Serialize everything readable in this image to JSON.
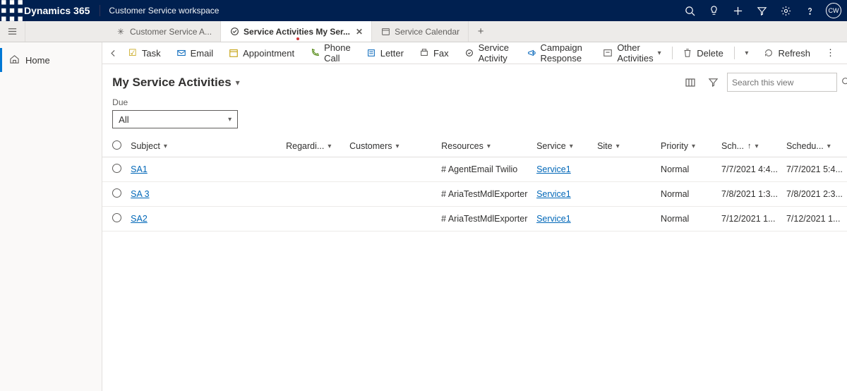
{
  "header": {
    "brand": "Dynamics 365",
    "app_name": "Customer Service workspace",
    "avatar_initials": "CW"
  },
  "tabs": {
    "items": [
      {
        "label": "Customer Service A...",
        "active": false,
        "closable": false
      },
      {
        "label": "Service Activities My Ser...",
        "active": true,
        "closable": true
      },
      {
        "label": "Service Calendar",
        "active": false,
        "closable": false
      }
    ]
  },
  "sidebar": {
    "home_label": "Home"
  },
  "command_bar": {
    "task": "Task",
    "email": "Email",
    "appointment": "Appointment",
    "phone_call": "Phone Call",
    "letter": "Letter",
    "fax": "Fax",
    "service_activity": "Service Activity",
    "campaign_response": "Campaign Response",
    "other_activities": "Other Activities",
    "delete": "Delete",
    "refresh": "Refresh"
  },
  "view": {
    "title": "My Service Activities",
    "search_placeholder": "Search this view",
    "filter": {
      "label": "Due",
      "value": "All"
    }
  },
  "columns": {
    "subject": "Subject",
    "regarding": "Regardi...",
    "customers": "Customers",
    "resources": "Resources",
    "service": "Service",
    "site": "Site",
    "priority": "Priority",
    "scheduled_start": "Sch...",
    "scheduled_end": "Schedu..."
  },
  "rows": [
    {
      "subject": "SA1",
      "resources": "# AgentEmail Twilio",
      "service": "Service1",
      "priority": "Normal",
      "scheduled_start": "7/7/2021 4:4...",
      "scheduled_end": "7/7/2021 5:4..."
    },
    {
      "subject": "SA 3",
      "resources": "# AriaTestMdlExporter",
      "service": "Service1",
      "priority": "Normal",
      "scheduled_start": "7/8/2021 1:3...",
      "scheduled_end": "7/8/2021 2:3..."
    },
    {
      "subject": "SA2",
      "resources": "# AriaTestMdlExporter",
      "service": "Service1",
      "priority": "Normal",
      "scheduled_start": "7/12/2021 1...",
      "scheduled_end": "7/12/2021 1..."
    }
  ]
}
